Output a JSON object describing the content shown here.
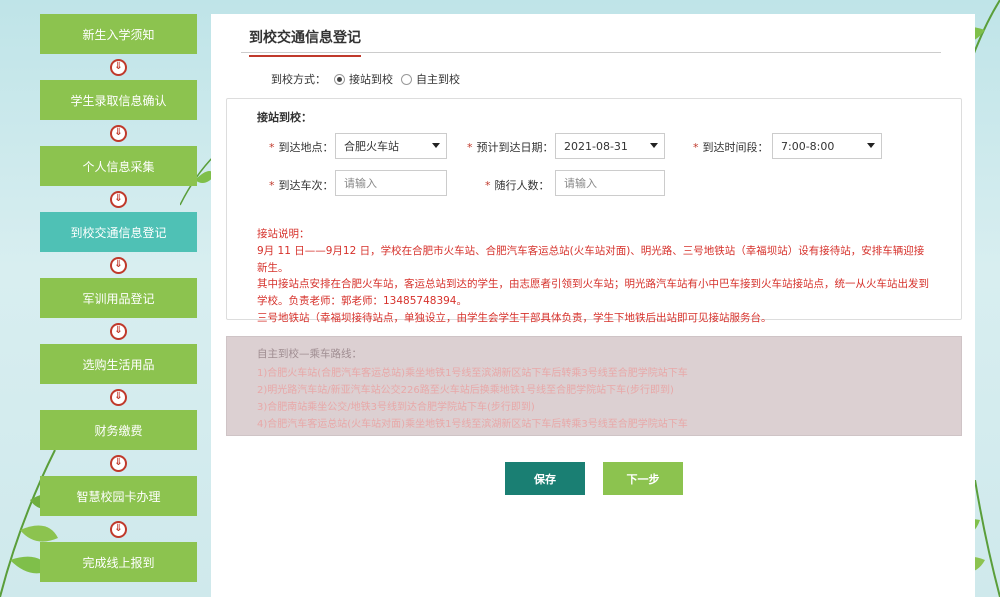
{
  "sidebar": {
    "steps": [
      {
        "label": "新生入学须知"
      },
      {
        "label": "学生录取信息确认"
      },
      {
        "label": "个人信息采集"
      },
      {
        "label": "到校交通信息登记"
      },
      {
        "label": "军训用品登记"
      },
      {
        "label": "选购生活用品"
      },
      {
        "label": "财务缴费"
      },
      {
        "label": "智慧校园卡办理"
      },
      {
        "label": "完成线上报到"
      }
    ],
    "active_index": 3,
    "arrow_glyph": "⇓"
  },
  "page": {
    "title": "到校交通信息登记",
    "mode_label": "到校方式：",
    "mode_options": [
      "接站到校",
      "自主到校"
    ],
    "mode_selected": "接站到校"
  },
  "pickup": {
    "title": "接站到校：",
    "location_label": "到达地点：",
    "location_value": "合肥火车站",
    "date_label": "预计到达日期：",
    "date_value": "2021-08-31",
    "time_label": "到达时间段：",
    "time_value": "7:00-8:00",
    "train_label": "到达车次：",
    "train_placeholder": "请输入",
    "companions_label": "随行人数：",
    "companions_placeholder": "请输入",
    "notes": [
      "接站说明：",
      "9月 11 日——9月12 日，学校在合肥市火车站、合肥汽车客运总站(火车站对面)、明光路、三号地铁站（幸福坝站）设有接待站，安排车辆迎接",
      "新生。",
      "其中接站点安排在合肥火车站，客运总站到达的学生，由志愿者引领到火车站；明光路汽车站有小中巴车接到火车站接站点，统一从火车站出发到",
      "学校。负责老师：郭老师：13485748394。",
      "三号地铁站（幸福坝接待站点，单独设立，由学生会学生干部具体负责，学生下地铁后出站即可见接站服务台。"
    ]
  },
  "self": {
    "title": "自主到校—乘车路线：",
    "lines": [
      "1)合肥火车站(合肥汽车客运总站)乘坐地铁1号线至滨湖新区站下车后转乘3号线至合肥学院站下车",
      "2)明光路汽车站/新亚汽车站公交226路至火车站后换乘地铁1号线至合肥学院站下车(步行即到)",
      "3)合肥南站乘坐公交/地铁3号线到达合肥学院站下车(步行即到)",
      "4)合肥汽车客运总站(火车站对面)乘坐地铁1号线至滨湖新区站下车后转乘3号线至合肥学院站下车"
    ]
  },
  "buttons": {
    "save": "保存",
    "next": "下一步"
  },
  "colors": {
    "step_green": "#8cc34f",
    "step_active": "#4fc1b5",
    "accent_red": "#c0392b",
    "save_btn": "#1a7f73"
  }
}
